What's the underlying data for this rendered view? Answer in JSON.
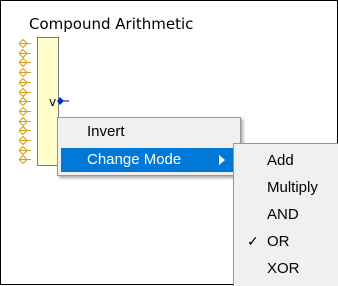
{
  "component": {
    "title": "Compound Arithmetic",
    "output_label": "v",
    "input_count": 13
  },
  "context_menu": {
    "items": [
      {
        "label": "Invert"
      },
      {
        "label": "Change Mode",
        "has_submenu": true,
        "highlighted": true
      }
    ]
  },
  "submenu": {
    "items": [
      {
        "label": "Add",
        "checked": false
      },
      {
        "label": "Multiply",
        "checked": false
      },
      {
        "label": "AND",
        "checked": false
      },
      {
        "label": "OR",
        "checked": true
      },
      {
        "label": "XOR",
        "checked": false
      }
    ],
    "check_glyph": "✓"
  },
  "colors": {
    "block_fill": "#ffffcc",
    "port_color": "#d4a017",
    "highlight": "#0078d7",
    "pin_color": "#0033cc"
  }
}
